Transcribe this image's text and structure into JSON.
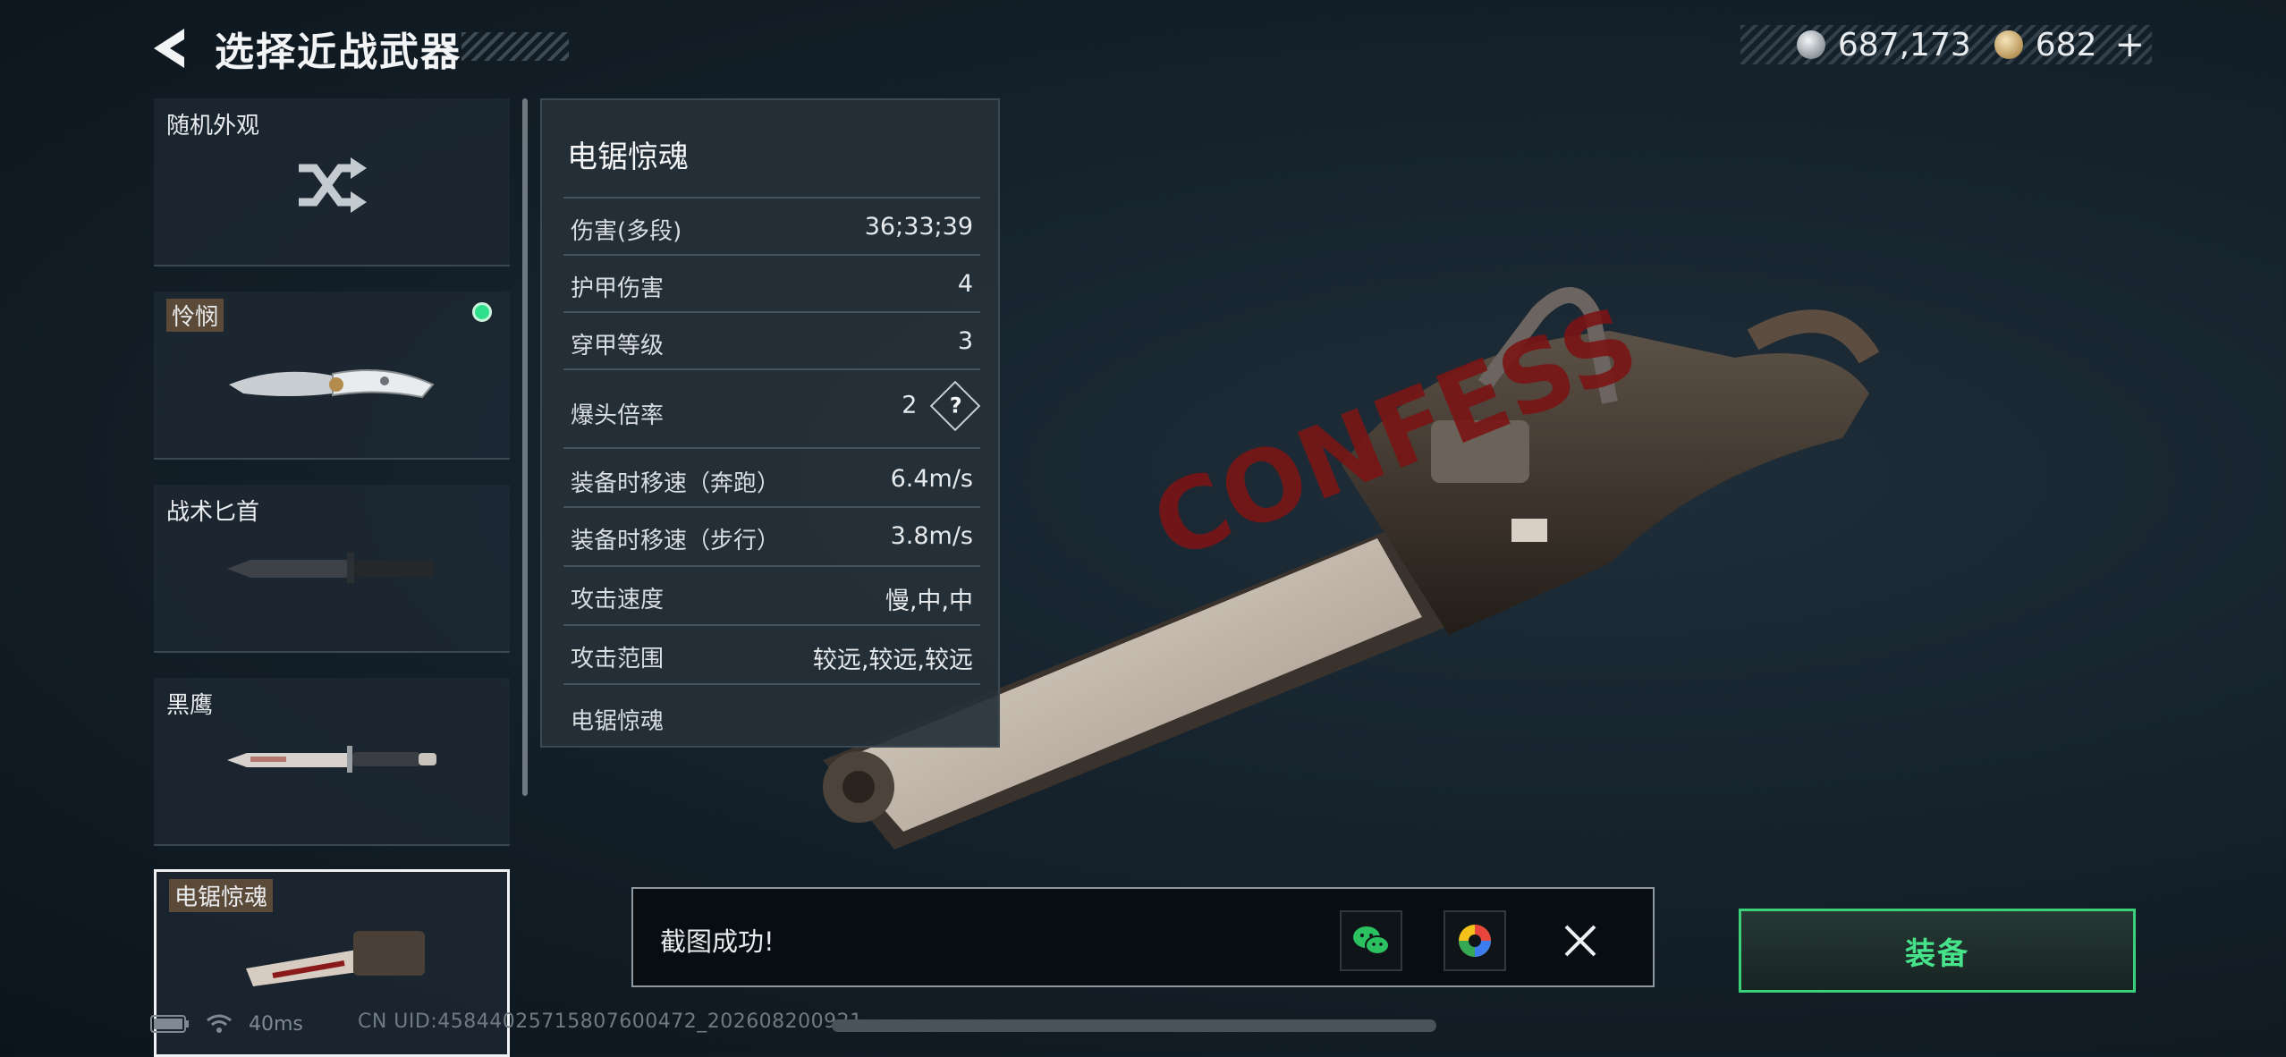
{
  "header": {
    "back_label": "返回",
    "title": "选择近战武器",
    "currency_silver": "687,173",
    "currency_gold": "682",
    "currency_plus": "+"
  },
  "weapons": [
    {
      "label": "随机外观"
    },
    {
      "label": "怜悯"
    },
    {
      "label": "战术匕首"
    },
    {
      "label": "黑鹰"
    },
    {
      "label": "电锯惊魂"
    }
  ],
  "panel": {
    "title": "电锯惊魂",
    "stats": [
      {
        "key": "伤害(多段)",
        "value": "36;33;39"
      },
      {
        "key": "护甲伤害",
        "value": "4"
      },
      {
        "key": "穿甲等级",
        "value": "3"
      },
      {
        "key": "爆头倍率",
        "value": "2"
      },
      {
        "key": "装备时移速（奔跑）",
        "value": "6.4m/s"
      },
      {
        "key": "装备时移速（步行）",
        "value": "3.8m/s"
      },
      {
        "key": "攻击速度",
        "value": "慢,中,中"
      },
      {
        "key": "攻击范围",
        "value": "较远,较远,较远"
      },
      {
        "key": "电锯惊魂",
        "value": ""
      }
    ],
    "help_icon": "?"
  },
  "toast": {
    "message": "截图成功!"
  },
  "equip_label": "装备",
  "status": {
    "ping": "40ms",
    "uid": "CN UID:4584402571580760047​2_2026082009​21"
  },
  "colors": {
    "accent_green": "#3bd17a",
    "selected_dot": "#2ee08a"
  }
}
